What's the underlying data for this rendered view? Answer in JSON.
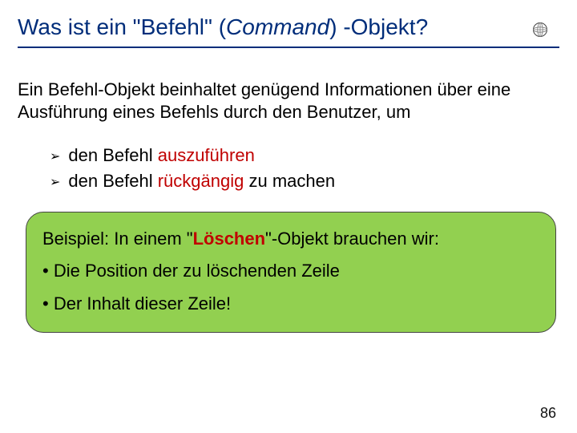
{
  "title": {
    "prefix": "Was ist ein \"Befehl\" (",
    "italic": "Command",
    "suffix": ") -Objekt?"
  },
  "intro": "Ein Befehl-Objekt beinhaltet genügend Informationen über eine Ausführung eines Befehls durch den Benutzer, um",
  "bullets": {
    "arrow": "➢",
    "items": [
      {
        "pre": "den Befehl ",
        "em": "auszuführen",
        "post": ""
      },
      {
        "pre": "den Befehl ",
        "em": "rückgängig",
        "post": " zu machen"
      }
    ]
  },
  "example": {
    "lead_pre": "Beispiel: In einem \"",
    "lead_em": "Löschen",
    "lead_post": "\"-Objekt brauchen wir:",
    "points": [
      "• Die Position der zu löschenden Zeile",
      "• Der Inhalt dieser Zeile!"
    ]
  },
  "page_number": "86"
}
